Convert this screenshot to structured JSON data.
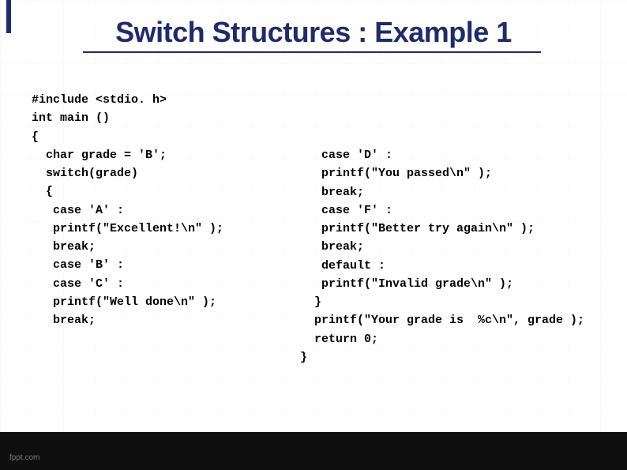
{
  "title": "Switch Structures : Example 1",
  "code_left": "#include <stdio. h>\nint main ()\n{\n  char grade = 'B';\n  switch(grade)\n  {\n   case 'A' :\n   printf(\"Excellent!\\n\" );\n   break;\n   case 'B' :\n   case 'C' :\n   printf(\"Well done\\n\" );\n   break;",
  "code_right": "   case 'D' :\n   printf(\"You passed\\n\" );\n   break;\n   case 'F' :\n   printf(\"Better try again\\n\" );\n   break;\n   default :\n   printf(\"Invalid grade\\n\" );\n  }\n  printf(\"Your grade is  %c\\n\", grade );\n  return 0;\n}",
  "footer_brand": "fppt.com"
}
